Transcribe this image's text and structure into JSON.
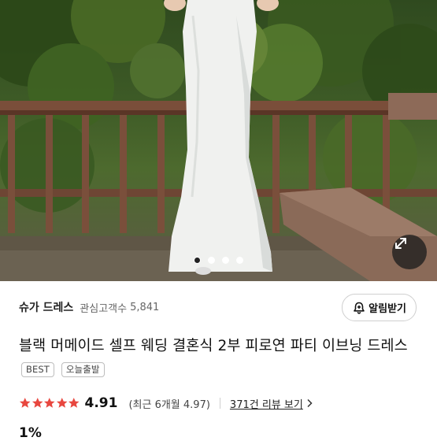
{
  "gallery": {
    "dots": [
      {
        "active": true
      },
      {
        "active": false
      },
      {
        "active": false
      },
      {
        "active": false
      }
    ],
    "expand_icon": "expand-arrows-icon"
  },
  "seller": {
    "name": "슈가 드레스",
    "interest_label": "관심고객수",
    "interest_count": "5,841",
    "alarm_label": "알림받기",
    "alarm_icon": "bell-plus-icon"
  },
  "product": {
    "title": "블랙 머메이드 셀프 웨딩 결혼식 2부 피로연 파티 이브닝 드레스",
    "badges": [
      "BEST",
      "오늘출발"
    ]
  },
  "rating": {
    "stars": 5,
    "star_color": "#e8473f",
    "score": "4.91",
    "recent": "(최근 6개월 4.97)",
    "review_link": "371건 리뷰 보기"
  },
  "price": {
    "discount": "1%"
  }
}
